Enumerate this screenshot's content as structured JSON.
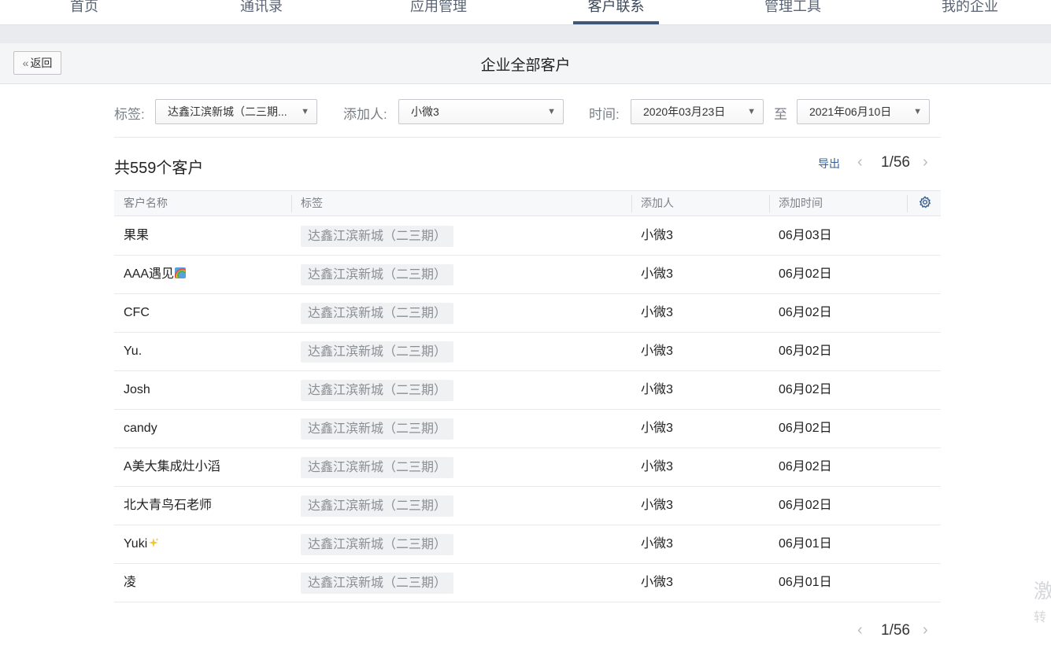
{
  "nav": {
    "items": [
      "首页",
      "通讯录",
      "应用管理",
      "客户联系",
      "管理工具",
      "我的企业"
    ],
    "active": "客户联系"
  },
  "header": {
    "back_label": "返回",
    "title": "企业全部客户"
  },
  "filters": {
    "tag_label": "标签:",
    "tag_value": "达鑫江滨新城（二三期...",
    "adder_label": "添加人:",
    "adder_value": "小微3",
    "time_label": "时间:",
    "start_date": "2020年03月23日",
    "to_label": "至",
    "end_date": "2021年06月10日"
  },
  "summary": {
    "total_text": "共559个客户",
    "export_label": "导出",
    "page_text": "1/56"
  },
  "table": {
    "columns": [
      "客户名称",
      "标签",
      "添加人",
      "添加时间"
    ],
    "rows": [
      {
        "name": "果果",
        "tag": "达鑫江滨新城（二三期）",
        "adder": "小微3",
        "time": "06月03日",
        "emoji": ""
      },
      {
        "name": "AAA遇见",
        "tag": "达鑫江滨新城（二三期）",
        "adder": "小微3",
        "time": "06月02日",
        "emoji": "rainbow-emoji"
      },
      {
        "name": "CFC",
        "tag": "达鑫江滨新城（二三期）",
        "adder": "小微3",
        "time": "06月02日",
        "emoji": ""
      },
      {
        "name": "Yu.",
        "tag": "达鑫江滨新城（二三期）",
        "adder": "小微3",
        "time": "06月02日",
        "emoji": ""
      },
      {
        "name": "Josh",
        "tag": "达鑫江滨新城（二三期）",
        "adder": "小微3",
        "time": "06月02日",
        "emoji": ""
      },
      {
        "name": "candy",
        "tag": "达鑫江滨新城（二三期）",
        "adder": "小微3",
        "time": "06月02日",
        "emoji": ""
      },
      {
        "name": "A美大集成灶小滔",
        "tag": "达鑫江滨新城（二三期）",
        "adder": "小微3",
        "time": "06月02日",
        "emoji": ""
      },
      {
        "name": "北大青鸟石老师",
        "tag": "达鑫江滨新城（二三期）",
        "adder": "小微3",
        "time": "06月02日",
        "emoji": ""
      },
      {
        "name": "Yuki",
        "tag": "达鑫江滨新城（二三期）",
        "adder": "小微3",
        "time": "06月01日",
        "emoji": "sparkles-emoji"
      },
      {
        "name": "凌",
        "tag": "达鑫江滨新城（二三期）",
        "adder": "小微3",
        "time": "06月01日",
        "emoji": ""
      }
    ]
  },
  "watermark": {
    "line1": "激",
    "line2": "转"
  },
  "colors": {
    "accent": "#3e5777",
    "link": "#3a5f91"
  }
}
